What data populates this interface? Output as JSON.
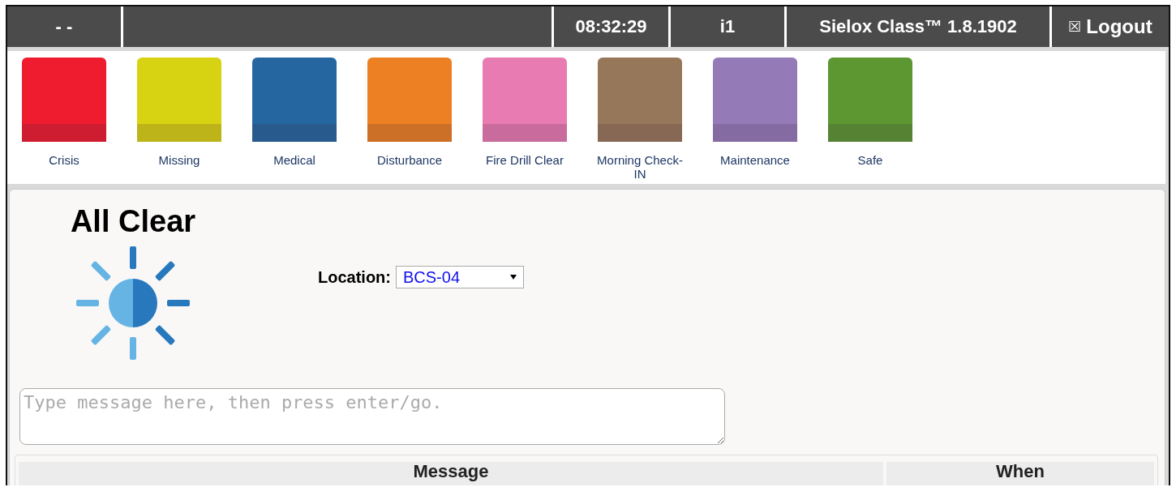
{
  "top_bar": {
    "cells": [
      {
        "text": "- -"
      },
      {
        "text": ""
      },
      {
        "text": "08:32:29"
      },
      {
        "text": "i1"
      },
      {
        "text": "Sielox Class™ 1.8.1902"
      }
    ],
    "logout": {
      "icon": "☒",
      "label": "Logout"
    }
  },
  "alerts": [
    {
      "label": "Crisis",
      "color": "#ee1c2e"
    },
    {
      "label": "Missing",
      "color": "#d8d312"
    },
    {
      "label": "Medical",
      "color": "#2566a0"
    },
    {
      "label": "Disturbance",
      "color": "#ec8023"
    },
    {
      "label": "Fire Drill Clear",
      "color": "#e87bb1"
    },
    {
      "label": "Morning Check-IN",
      "color": "#97775a"
    },
    {
      "label": "Maintenance",
      "color": "#947bb8"
    },
    {
      "label": "Safe",
      "color": "#5c9732"
    }
  ],
  "status": {
    "title": "All Clear"
  },
  "location": {
    "label": "Location:",
    "value": "BCS-04"
  },
  "message_box": {
    "placeholder": "Type message here, then press enter/go."
  },
  "table": {
    "columns": [
      "Message",
      "When"
    ]
  }
}
